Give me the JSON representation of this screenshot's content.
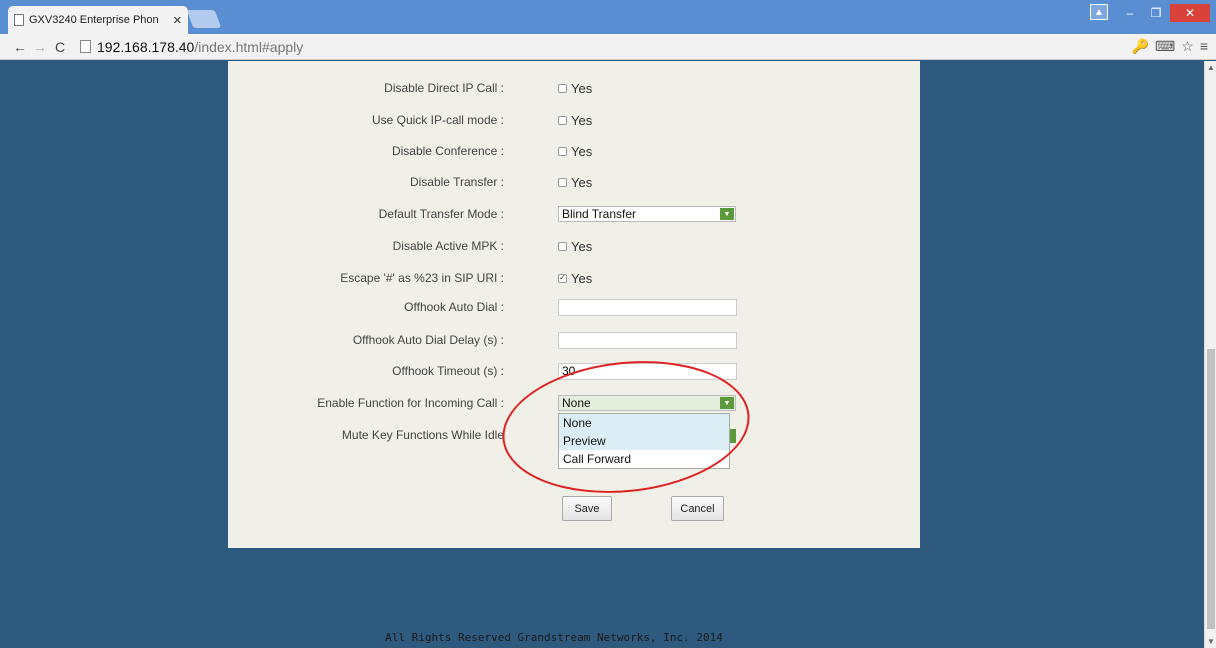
{
  "browser": {
    "tab_title": "GXV3240 Enterprise Phon",
    "tab_close": "✕",
    "url_host": "192.168.178.40",
    "url_path": "/index.html#apply"
  },
  "form": {
    "rows": [
      {
        "label": "Disable Direct IP Call :",
        "value": "Yes",
        "checked": false
      },
      {
        "label": "Use Quick IP-call mode :",
        "value": "Yes",
        "checked": false
      },
      {
        "label": "Disable Conference :",
        "value": "Yes",
        "checked": false
      },
      {
        "label": "Disable Transfer :",
        "value": "Yes",
        "checked": false
      },
      {
        "label": "Default Transfer Mode :",
        "value": "Blind Transfer"
      },
      {
        "label": "Disable Active MPK :",
        "value": "Yes",
        "checked": false
      },
      {
        "label": "Escape '#' as %23 in SIP URI :",
        "value": "Yes",
        "checked": true
      },
      {
        "label": "Offhook Auto Dial :",
        "value": ""
      },
      {
        "label": "Offhook Auto Dial Delay (s) :",
        "value": ""
      },
      {
        "label": "Offhook Timeout (s) :",
        "value": "30"
      },
      {
        "label": "Enable Function for Incoming Call :",
        "value": "None"
      },
      {
        "label": "Mute Key Functions While Idle"
      }
    ],
    "dropdown_options": [
      "None",
      "Preview",
      "Call Forward"
    ],
    "save_label": "Save",
    "cancel_label": "Cancel"
  },
  "footer": "All Rights Reserved Grandstream Networks, Inc. 2014",
  "colors": {
    "background": "#2e5a7f",
    "panel": "#f0f0e8",
    "select_arrow": "#5a9a3d",
    "highlight_circle": "#e02020"
  }
}
